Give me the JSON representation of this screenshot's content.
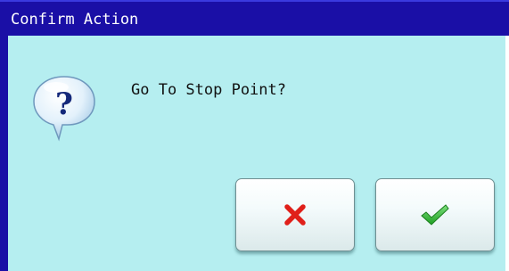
{
  "window": {
    "title": "Confirm Action"
  },
  "dialog": {
    "icon": "question-bubble-icon",
    "message": "Go To Stop Point?"
  },
  "buttons": {
    "cancel": {
      "icon": "red-x-icon",
      "color": "#e0201a"
    },
    "confirm": {
      "icon": "green-check-icon",
      "color": "#2bb52b"
    }
  },
  "colors": {
    "titlebar": "#1a0fa6",
    "background": "#b5eef0"
  }
}
